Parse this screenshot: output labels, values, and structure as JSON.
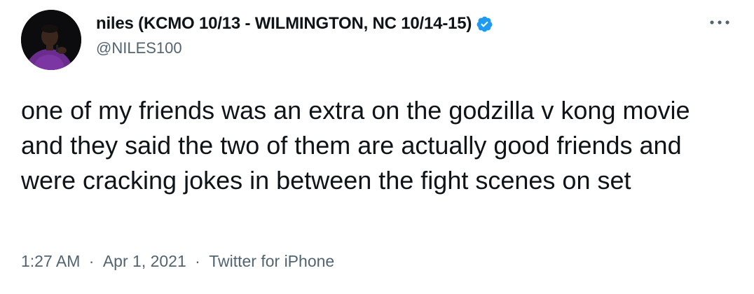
{
  "author": {
    "display_name": "niles (KCMO 10/13 - WILMINGTON, NC 10/14-15)",
    "handle": "@NILES100",
    "verified_icon": "verified-badge-icon",
    "verified_color": "#1d9bf0"
  },
  "more_menu_icon": "more-horizontal-icon",
  "tweet": {
    "text": "one of my friends was an extra on the godzilla v kong movie and they said the two of them are actually good friends and were cracking jokes in between the fight scenes on set"
  },
  "meta": {
    "time": "1:27 AM",
    "separator_1": "·",
    "date": "Apr 1, 2021",
    "separator_2": "·",
    "source": "Twitter for iPhone"
  },
  "colors": {
    "text_primary": "#0f1419",
    "text_secondary": "#536471",
    "background": "#ffffff"
  }
}
